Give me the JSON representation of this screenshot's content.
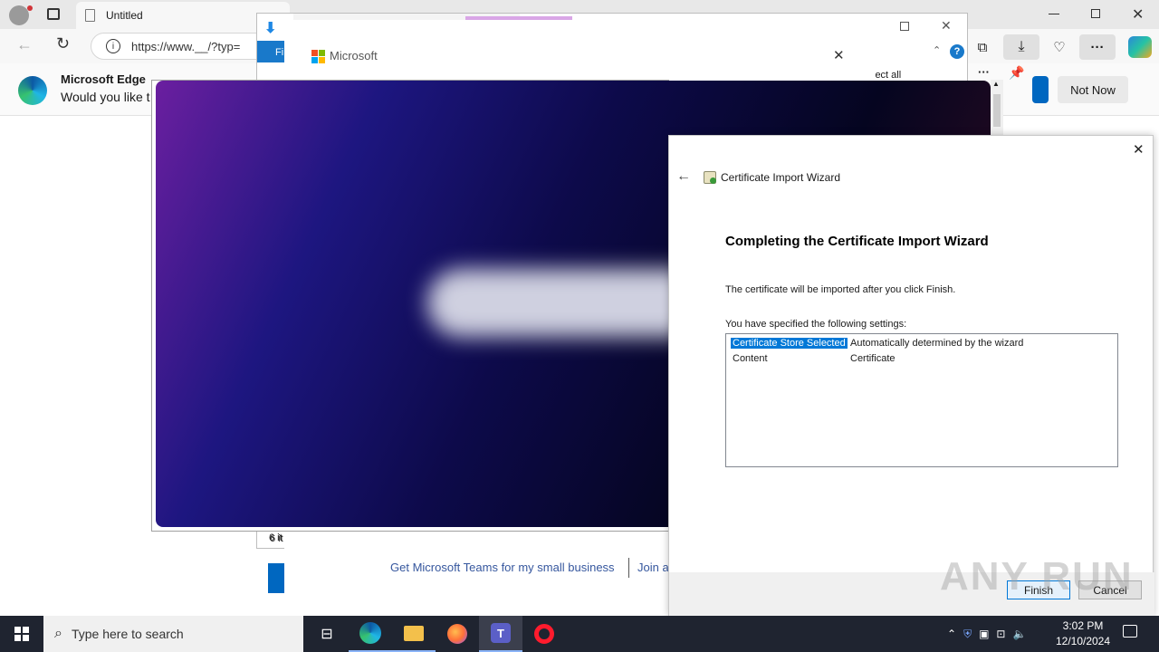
{
  "browser": {
    "tab_title": "Untitled",
    "url": "https://www.__/?typ=",
    "infobar_title": "Microsoft Edge",
    "infobar_text": "Would you like t",
    "not_now": "Not Now"
  },
  "explorer": {
    "menu_label": "Fi",
    "select_all": "lect all",
    "items_count": "6 it"
  },
  "teams": {
    "brand": "Microsoft",
    "link1": "Get Microsoft Teams for my small business",
    "link2": "Join a"
  },
  "wizard": {
    "title": "Certificate Import Wizard",
    "heading": "Completing the Certificate Import Wizard",
    "info": "The certificate will be imported after you click Finish.",
    "settings_label": "You have specified the following settings:",
    "settings": [
      {
        "key": "Certificate Store Selected",
        "value": "Automatically determined by the wizard"
      },
      {
        "key": "Content",
        "value": "Certificate"
      }
    ],
    "finish": "Finish",
    "cancel": "Cancel"
  },
  "taskbar": {
    "search_placeholder": "Type here to search",
    "time": "3:02 PM",
    "date": "12/10/2024"
  },
  "watermark": "ANY RUN",
  "colors": {
    "accent": "#0067c0",
    "selection": "#0078d7",
    "taskbar": "#1f2430"
  }
}
